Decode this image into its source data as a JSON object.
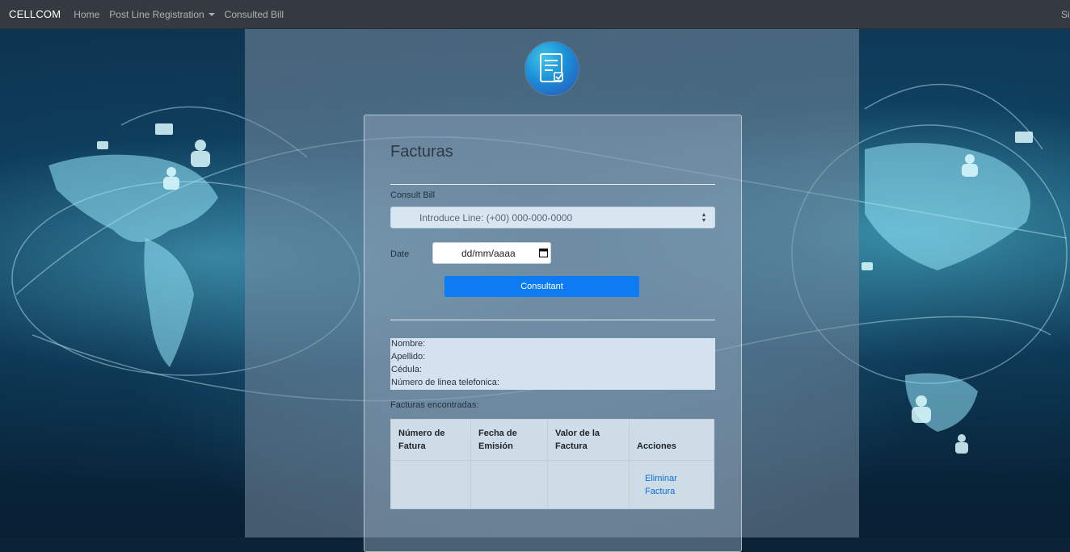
{
  "navbar": {
    "brand": "CELLCOM",
    "items": [
      {
        "label": "Home"
      },
      {
        "label": "Post Line Registration",
        "dropdown": true
      },
      {
        "label": "Consulted Bill"
      }
    ],
    "right_label": "Sig"
  },
  "logo": {
    "icon": "document-check-icon"
  },
  "form": {
    "title": "Facturas",
    "consult_label": "Consult Bill",
    "line_placeholder": "Introduce Line: (+00) 000-000-0000",
    "date_label": "Date",
    "date_value": "dd/mm/aaaa",
    "submit_label": "Consultant"
  },
  "info": {
    "nombre": "Nombre:",
    "apellido": "Apellido:",
    "cedula": "Cédula:",
    "linea": "Número de linea telefonica:"
  },
  "results": {
    "caption": "Facturas encontradas:",
    "columns": [
      "Número de Fatura",
      "Fecha de Emisión",
      "Valor de la Factura",
      "Acciones"
    ],
    "rows": [
      {
        "numero": "",
        "fecha": "",
        "valor": "",
        "action_label": "Eliminar Factura"
      }
    ]
  },
  "colors": {
    "navbar": "#343a40",
    "primary": "#0d7cf2",
    "link": "#0d6fd6"
  }
}
